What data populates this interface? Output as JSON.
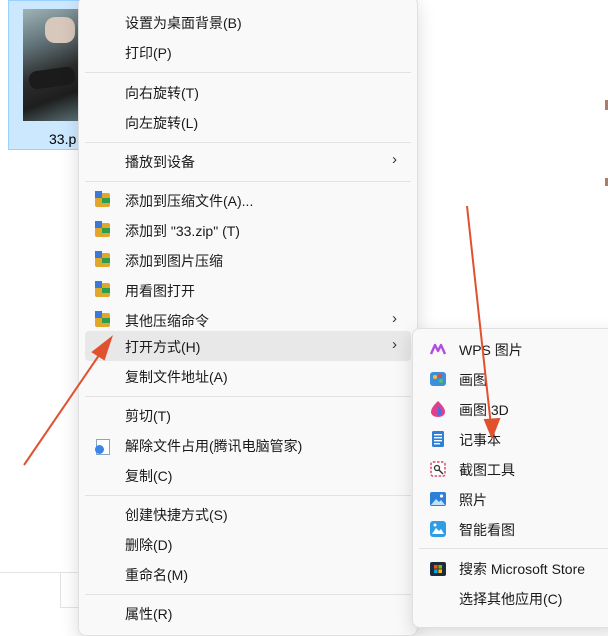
{
  "file": {
    "name": "33.p"
  },
  "context_menu": {
    "items": [
      {
        "label": "设置为桌面背景(B)"
      },
      {
        "label": "打印(P)"
      },
      {
        "label": "向右旋转(T)"
      },
      {
        "label": "向左旋转(L)"
      },
      {
        "label": "播放到设备"
      },
      {
        "label": "添加到压缩文件(A)..."
      },
      {
        "label": "添加到 \"33.zip\" (T)"
      },
      {
        "label": "添加到图片压缩"
      },
      {
        "label": "用看图打开"
      },
      {
        "label": "其他压缩命令"
      },
      {
        "label": "打开方式(H)"
      },
      {
        "label": "复制文件地址(A)"
      },
      {
        "label": "剪切(T)"
      },
      {
        "label": "解除文件占用(腾讯电脑管家)"
      },
      {
        "label": "复制(C)"
      },
      {
        "label": "创建快捷方式(S)"
      },
      {
        "label": "删除(D)"
      },
      {
        "label": "重命名(M)"
      },
      {
        "label": "属性(R)"
      }
    ],
    "submenu_chevron": "›"
  },
  "open_with_submenu": {
    "items": [
      {
        "label": "WPS 图片"
      },
      {
        "label": "画图"
      },
      {
        "label": "画图 3D"
      },
      {
        "label": "记事本"
      },
      {
        "label": "截图工具"
      },
      {
        "label": "照片"
      },
      {
        "label": "智能看图"
      },
      {
        "label": "搜索 Microsoft Store"
      },
      {
        "label": "选择其他应用(C)"
      }
    ]
  },
  "annotation": {
    "arrow_color": "#e0522e"
  }
}
